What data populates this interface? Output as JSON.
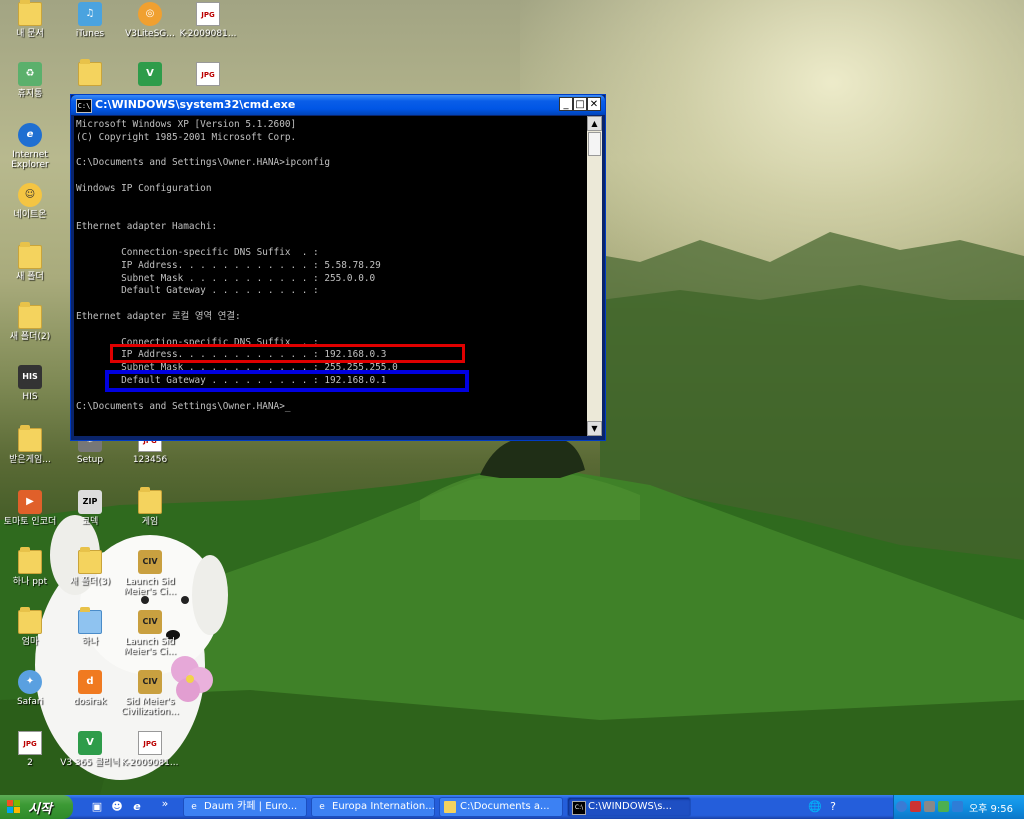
{
  "desktop_icons": [
    {
      "name": "my-documents-icon",
      "label": "내 문서",
      "kind": "folder"
    },
    {
      "name": "itunes-icon",
      "label": "iTunes",
      "kind": "itunes"
    },
    {
      "name": "v3lite-icon",
      "label": "V3LiteSG...",
      "kind": "v3lite"
    },
    {
      "name": "jpg-file-icon",
      "label": "K-2009081...",
      "kind": "jpg"
    },
    {
      "name": "recycle-bin-icon",
      "label": "휴지통",
      "kind": "recycle"
    },
    {
      "name": "folder-icon",
      "label": "",
      "kind": "folder"
    },
    {
      "name": "v3-shortcut-icon",
      "label": "",
      "kind": "v3"
    },
    {
      "name": "jpg-file-icon",
      "label": "",
      "kind": "jpg"
    },
    {
      "name": "internet-explorer-icon",
      "label": "Internet Explorer",
      "kind": "ie"
    },
    {
      "name": "messenger-icon",
      "label": "네이트온",
      "kind": "nate"
    },
    {
      "name": "folder-icon",
      "label": "새 폴더",
      "kind": "folder"
    },
    {
      "name": "folder-icon",
      "label": "새 폴더(2)",
      "kind": "folder"
    },
    {
      "name": "his-icon",
      "label": "HIS",
      "kind": "his"
    },
    {
      "name": "folder-icon",
      "label": "받은게임...",
      "kind": "folder"
    },
    {
      "name": "setup-icon",
      "label": "Setup",
      "kind": "setup"
    },
    {
      "name": "jpg-file-icon",
      "label": "123456",
      "kind": "jpg"
    },
    {
      "name": "toma-icon",
      "label": "토마토 인코더",
      "kind": "toma"
    },
    {
      "name": "zip-icon",
      "label": "코덱",
      "kind": "zip"
    },
    {
      "name": "folder-icon",
      "label": "게임",
      "kind": "folder"
    },
    {
      "name": "folder-icon",
      "label": "하나 ppt",
      "kind": "folder"
    },
    {
      "name": "folder-icon",
      "label": "새 폴더(3)",
      "kind": "folder"
    },
    {
      "name": "civ-icon",
      "label": "Launch Sid Meier's Ci...",
      "kind": "civ"
    },
    {
      "name": "folder-icon",
      "label": "엄마",
      "kind": "folder"
    },
    {
      "name": "folder-icon",
      "label": "하나",
      "kind": "folderblue"
    },
    {
      "name": "civ-icon",
      "label": "Launch Sid Meier's Ci...",
      "kind": "civ"
    },
    {
      "name": "safari-icon",
      "label": "Safari",
      "kind": "safari"
    },
    {
      "name": "dosirak-icon",
      "label": "dosirak",
      "kind": "dosirak"
    },
    {
      "name": "civ-icon",
      "label": "Sid Meier's Civilization...",
      "kind": "civ"
    },
    {
      "name": "jpg-file-icon",
      "label": "2",
      "kind": "jpg"
    },
    {
      "name": "v3-icon",
      "label": "V3 365 클리닉",
      "kind": "v3"
    },
    {
      "name": "jpg-file-icon",
      "label": "K-2009081...",
      "kind": "jpg"
    }
  ],
  "cmd": {
    "title": "C:\\WINDOWS\\system32\\cmd.exe",
    "icon_text": "C:\\",
    "minimize": "_",
    "maximize": "□",
    "close": "✕",
    "scroll_up": "▲",
    "scroll_down": "▼",
    "lines": [
      "Microsoft Windows XP [Version 5.1.2600]",
      "(C) Copyright 1985-2001 Microsoft Corp.",
      "",
      "C:\\Documents and Settings\\Owner.HANA>ipconfig",
      "",
      "Windows IP Configuration",
      "",
      "",
      "Ethernet adapter Hamachi:",
      "",
      "        Connection-specific DNS Suffix  . :",
      "        IP Address. . . . . . . . . . . . : 5.58.78.29",
      "        Subnet Mask . . . . . . . . . . . : 255.0.0.0",
      "        Default Gateway . . . . . . . . . :",
      "",
      "Ethernet adapter 로컬 영역 연결:",
      "",
      "        Connection-specific DNS Suffix  . :",
      "        IP Address. . . . . . . . . . . . : 192.168.0.3",
      "        Subnet Mask . . . . . . . . . . . : 255.255.255.0",
      "        Default Gateway . . . . . . . . . : 192.168.0.1",
      "",
      "C:\\Documents and Settings\\Owner.HANA>_"
    ],
    "highlight_colors": {
      "ip": "#e00000",
      "gateway": "#0000e0"
    }
  },
  "taskbar": {
    "start_label": "시작",
    "quick_launch": [
      "desktop-icon",
      "messenger-icon",
      "ie-icon"
    ],
    "overflow": "»",
    "buttons": [
      {
        "label": "Daum 카페 | Euro...",
        "icon": "ie-icon",
        "active": false
      },
      {
        "label": "Europa Internation...",
        "icon": "ie-icon",
        "active": false
      },
      {
        "label": "C:\\Documents a...",
        "icon": "folder-icon",
        "active": false
      },
      {
        "label": "C:\\WINDOWS\\s...",
        "icon": "cmd-icon",
        "active": true
      }
    ],
    "clock": "오후 9:56"
  }
}
